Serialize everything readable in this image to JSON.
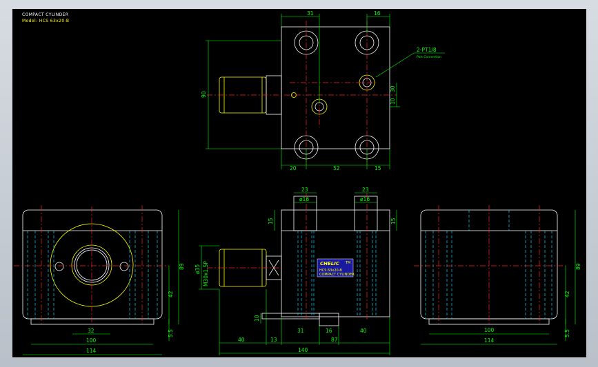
{
  "title": "COMPACT CYLINDER",
  "model": "Model: HCS 63x20-B",
  "callout": {
    "port": "2-PT1/8",
    "port_sub": "Port Connection"
  },
  "label_plate": {
    "brand": "CHELIC",
    "mark": "TM",
    "line1": "HCS 63x20-B",
    "line2": "COMPACT CYLINDER"
  },
  "top_view": {
    "dim_top_left": "31",
    "dim_top_right": "16",
    "dim_height": "90",
    "dim_side_a": "10",
    "dim_side_b": "30",
    "dim_bottom_left": "20",
    "dim_bottom_mid": "52",
    "dim_bottom_right": "15"
  },
  "front_view": {
    "dim_top_left": "23",
    "dim_top_right": "23",
    "dia_left": "ø16",
    "dia_right": "ø16",
    "dim_left_15": "15",
    "dim_right_15": "15",
    "rod_dia": "ø35",
    "thread": "M30x1.5P",
    "dim_10": "10",
    "dim_row": [
      "40",
      "13",
      "31",
      "16",
      "40"
    ],
    "dim_87": "87",
    "dim_140": "140"
  },
  "left_view": {
    "dim_32": "32",
    "dim_100": "100",
    "dim_114": "114",
    "dim_89": "89",
    "dim_42": "42",
    "dim_55": "5.5"
  },
  "right_view": {
    "dim_100": "100",
    "dim_114": "114",
    "dim_89": "89",
    "dim_42": "42",
    "dim_55": "5.5"
  }
}
